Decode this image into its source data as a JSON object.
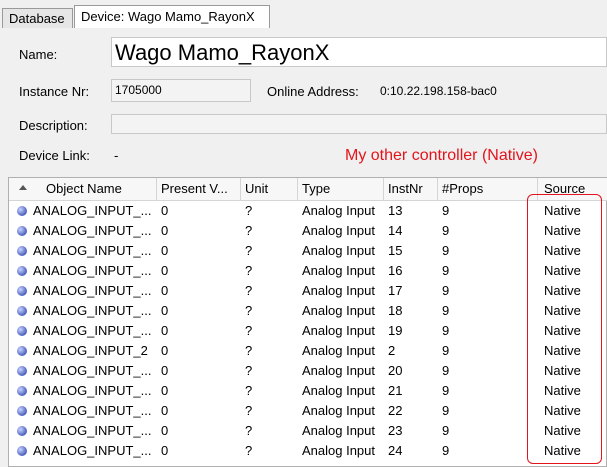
{
  "tabs": {
    "database": "Database",
    "device": "Device: Wago Mamo_RayonX"
  },
  "fields": {
    "name_label": "Name:",
    "name_value": "Wago Mamo_RayonX",
    "instance_label": "Instance Nr:",
    "instance_value": "1705000",
    "online_label": "Online Address:",
    "online_value": "0:10.22.198.158-bac0",
    "description_label": "Description:",
    "description_value": "",
    "devicelink_label": "Device Link:",
    "devicelink_value": "-"
  },
  "annotation": {
    "text": "My other controller (Native)",
    "color": "#e3141c"
  },
  "table": {
    "headers": {
      "object_name": "Object Name",
      "present_value": "Present V...",
      "unit": "Unit",
      "type": "Type",
      "instnr": "InstNr",
      "props": "#Props",
      "source": "Source"
    },
    "rows": [
      {
        "name": "ANALOG_INPUT_...",
        "pv": "0",
        "unit": "?",
        "type": "Analog Input",
        "inst": "13",
        "props": "9",
        "source": "Native"
      },
      {
        "name": "ANALOG_INPUT_...",
        "pv": "0",
        "unit": "?",
        "type": "Analog Input",
        "inst": "14",
        "props": "9",
        "source": "Native"
      },
      {
        "name": "ANALOG_INPUT_...",
        "pv": "0",
        "unit": "?",
        "type": "Analog Input",
        "inst": "15",
        "props": "9",
        "source": "Native"
      },
      {
        "name": "ANALOG_INPUT_...",
        "pv": "0",
        "unit": "?",
        "type": "Analog Input",
        "inst": "16",
        "props": "9",
        "source": "Native"
      },
      {
        "name": "ANALOG_INPUT_...",
        "pv": "0",
        "unit": "?",
        "type": "Analog Input",
        "inst": "17",
        "props": "9",
        "source": "Native"
      },
      {
        "name": "ANALOG_INPUT_...",
        "pv": "0",
        "unit": "?",
        "type": "Analog Input",
        "inst": "18",
        "props": "9",
        "source": "Native"
      },
      {
        "name": "ANALOG_INPUT_...",
        "pv": "0",
        "unit": "?",
        "type": "Analog Input",
        "inst": "19",
        "props": "9",
        "source": "Native"
      },
      {
        "name": "ANALOG_INPUT_2",
        "pv": "0",
        "unit": "?",
        "type": "Analog Input",
        "inst": "2",
        "props": "9",
        "source": "Native"
      },
      {
        "name": "ANALOG_INPUT_...",
        "pv": "0",
        "unit": "?",
        "type": "Analog Input",
        "inst": "20",
        "props": "9",
        "source": "Native"
      },
      {
        "name": "ANALOG_INPUT_...",
        "pv": "0",
        "unit": "?",
        "type": "Analog Input",
        "inst": "21",
        "props": "9",
        "source": "Native"
      },
      {
        "name": "ANALOG_INPUT_...",
        "pv": "0",
        "unit": "?",
        "type": "Analog Input",
        "inst": "22",
        "props": "9",
        "source": "Native"
      },
      {
        "name": "ANALOG_INPUT_...",
        "pv": "0",
        "unit": "?",
        "type": "Analog Input",
        "inst": "23",
        "props": "9",
        "source": "Native"
      },
      {
        "name": "ANALOG_INPUT_...",
        "pv": "0",
        "unit": "?",
        "type": "Analog Input",
        "inst": "24",
        "props": "9",
        "source": "Native"
      }
    ]
  },
  "icons": {
    "row_icon": "analog-object-icon",
    "sort_icon": "sort-ascending-icon"
  }
}
